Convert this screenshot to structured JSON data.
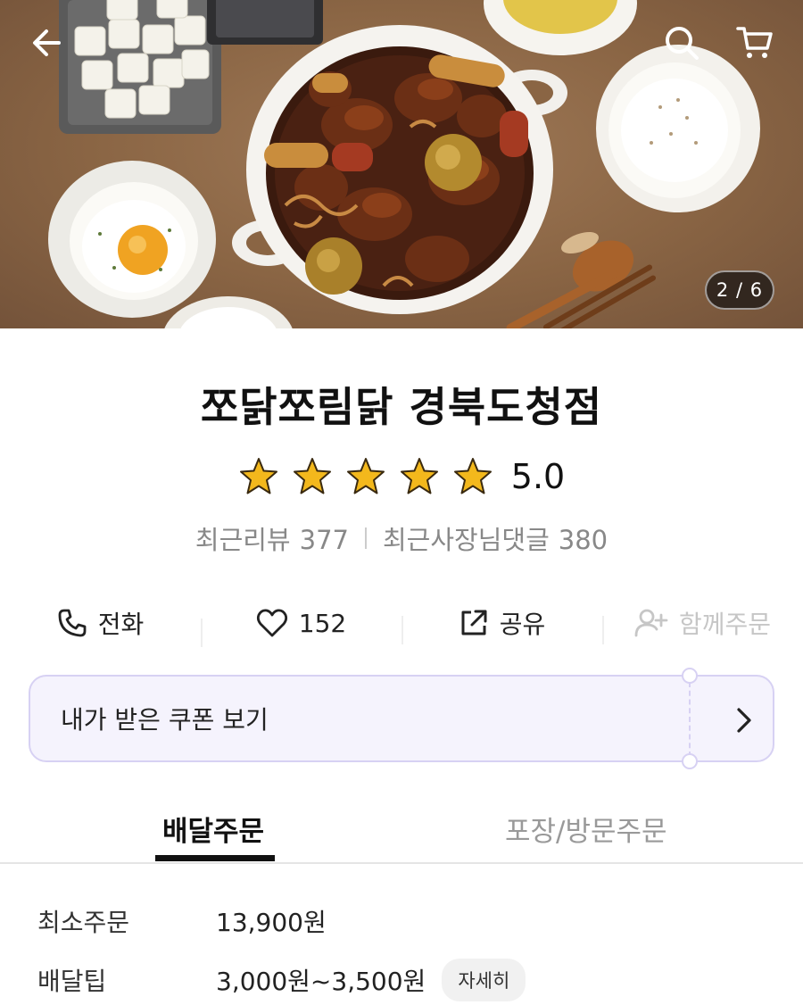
{
  "hero": {
    "page_counter": "2 / 6",
    "icons": {
      "back": "arrow-left-icon",
      "search": "search-icon",
      "cart": "cart-icon"
    }
  },
  "store": {
    "name": "쪼닭쪼림닭 경북도청점",
    "rating": 5.0,
    "rating_text": "5.0",
    "stars_filled": 5,
    "stars_total": 5,
    "star_color": "#f3b81c",
    "recent_reviews_label": "최근리뷰",
    "recent_reviews_count": "377",
    "owner_replies_label": "최근사장님댓글",
    "owner_replies_count": "380"
  },
  "actions": {
    "call": {
      "label": "전화",
      "icon": "phone-icon"
    },
    "like": {
      "label": "152",
      "icon": "heart-icon"
    },
    "share": {
      "label": "공유",
      "icon": "share-icon"
    },
    "group_order": {
      "label": "함께주문",
      "icon": "add-user-icon",
      "disabled": true
    }
  },
  "coupon": {
    "label": "내가 받은 쿠폰 보기",
    "accent": "#d7d1f3",
    "background": "#f5f3fd"
  },
  "tabs": [
    {
      "label": "배달주문",
      "active": true
    },
    {
      "label": "포장/방문주문",
      "active": false
    }
  ],
  "info": {
    "min_order_label": "최소주문",
    "min_order_value": "13,900원",
    "delivery_tip_label": "배달팁",
    "delivery_tip_value": "3,000원~3,500원",
    "detail_label": "자세히"
  }
}
